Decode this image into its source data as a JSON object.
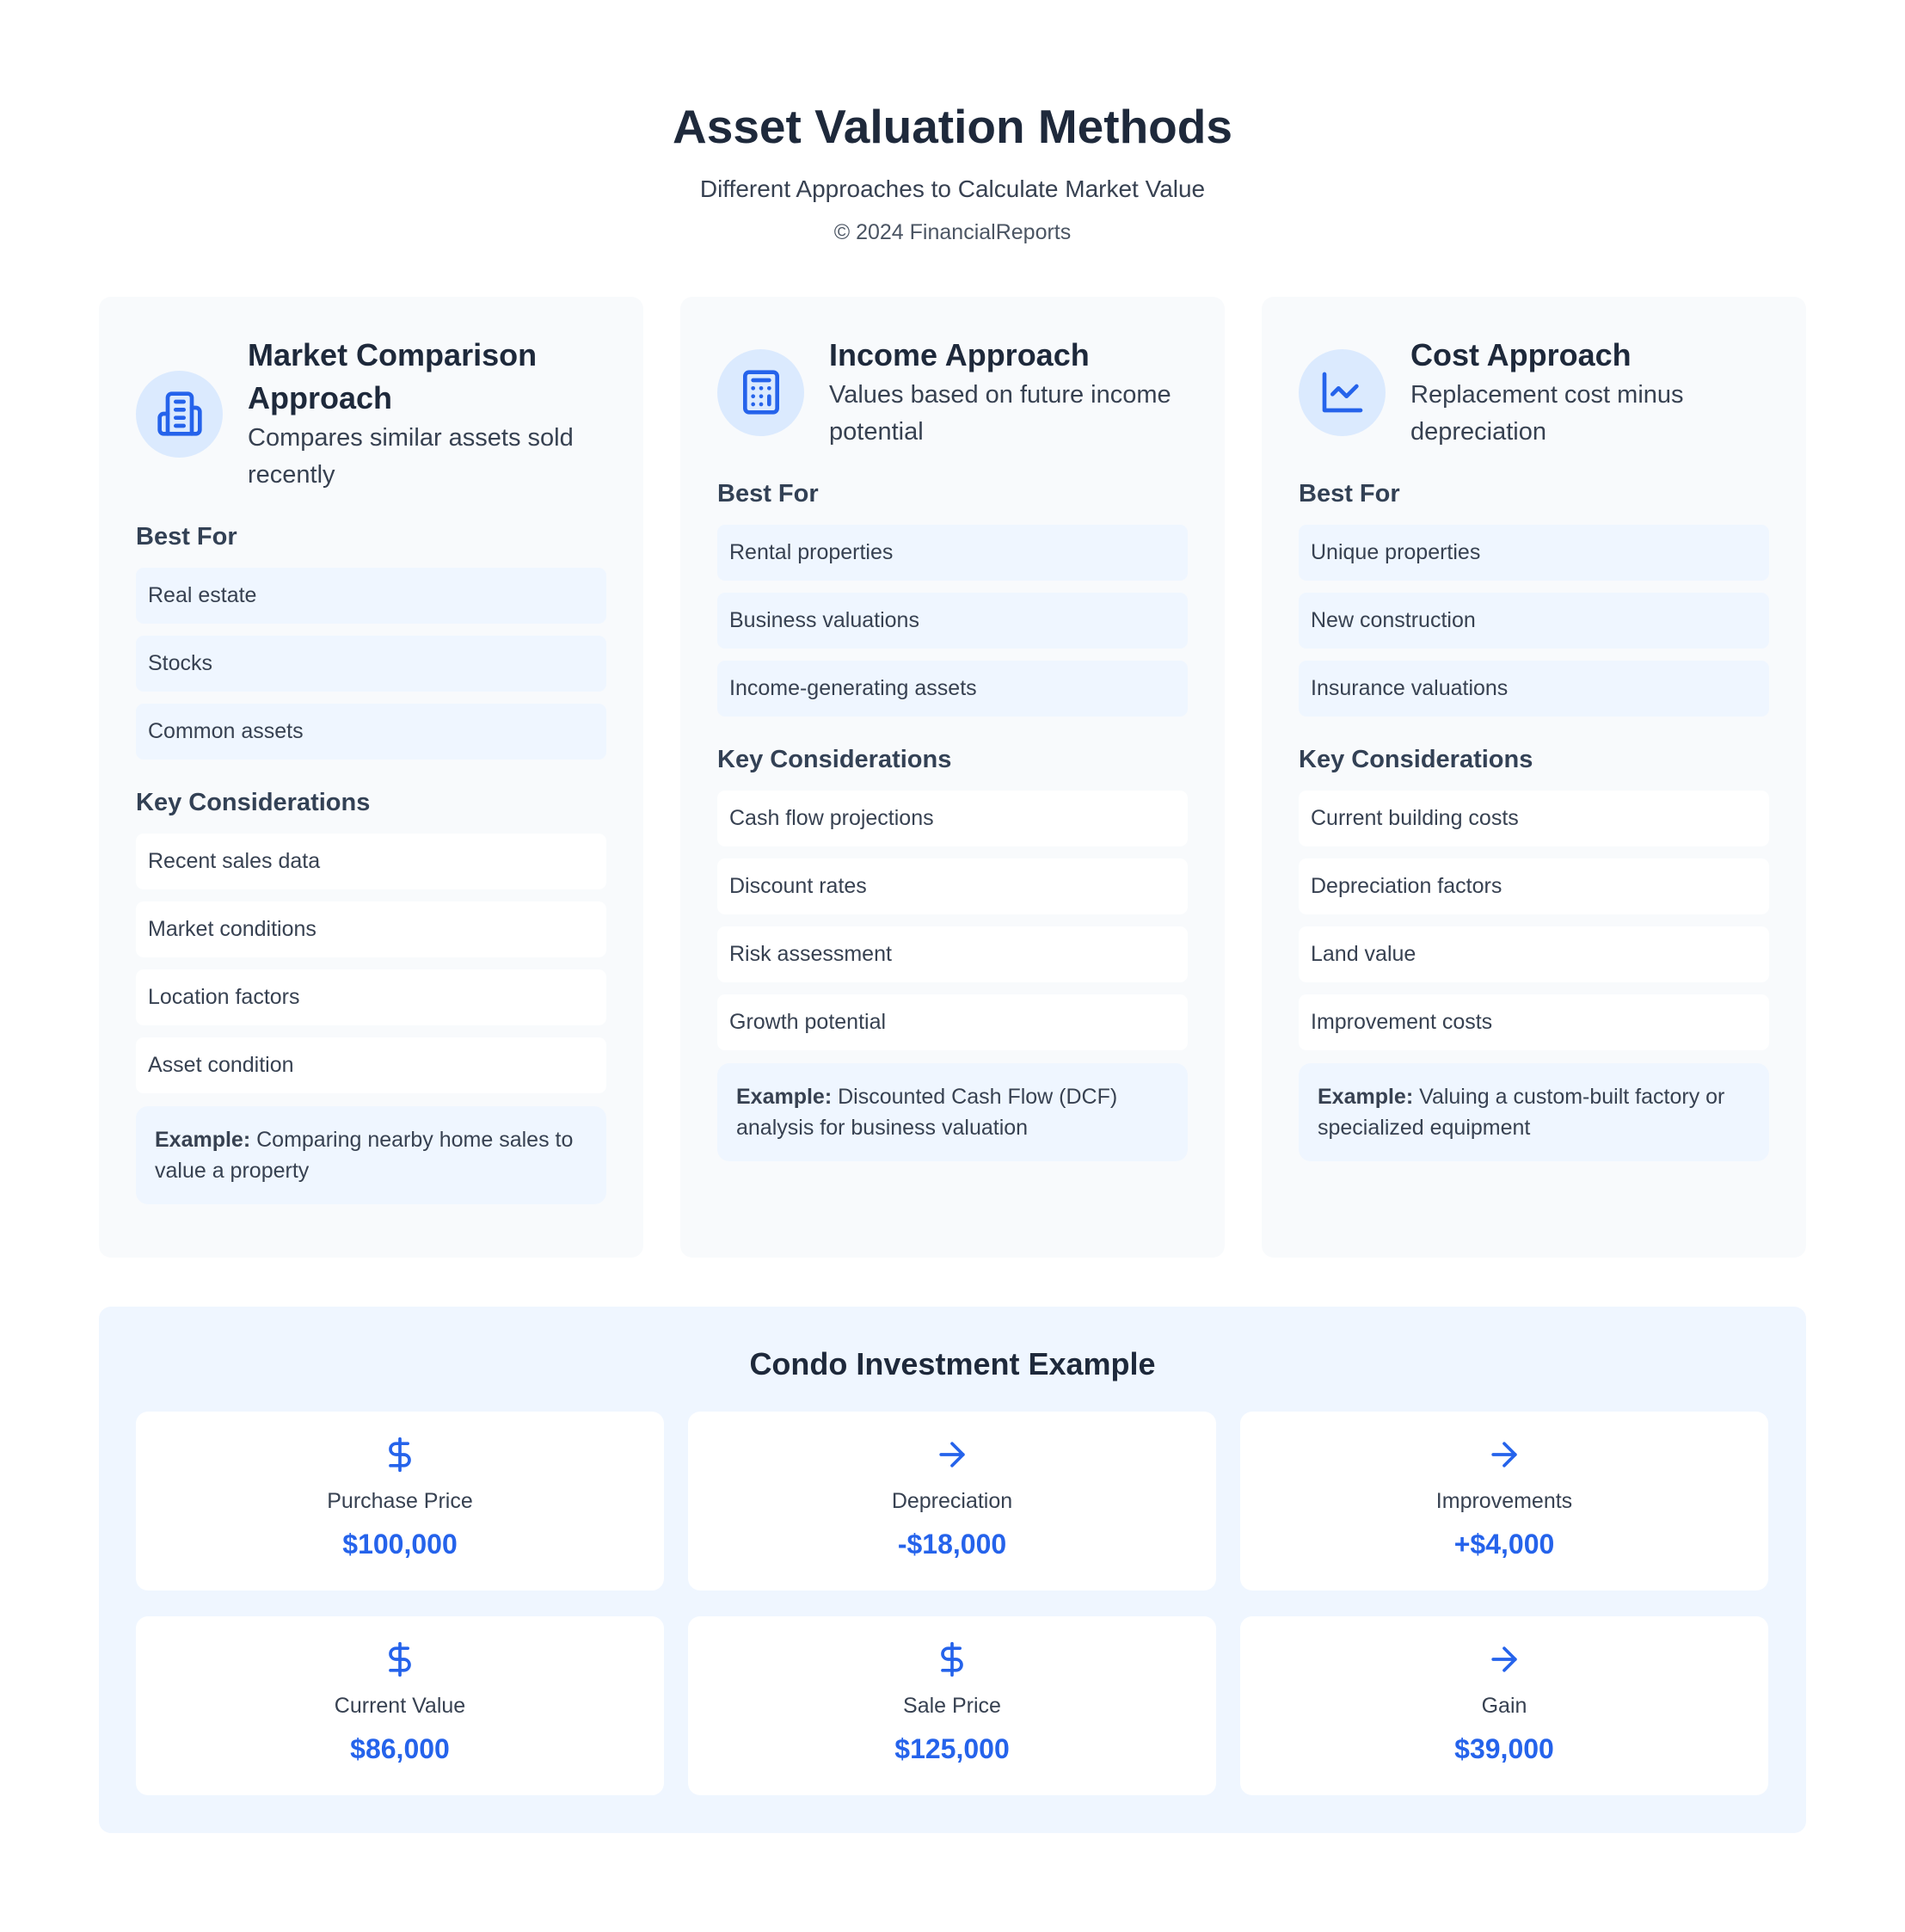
{
  "header": {
    "title": "Asset Valuation Methods",
    "subtitle": "Different Approaches to Calculate Market Value",
    "copyright": "© 2024 FinancialReports"
  },
  "colors": {
    "accent": "#2563eb",
    "icon_bg": "#dbeafe",
    "card_bg": "#f8fafc",
    "light_blue": "#eff6ff"
  },
  "methods": [
    {
      "icon": "building-icon",
      "title": "Market Comparison Approach",
      "description": "Compares similar assets sold recently",
      "best_for_label": "Best For",
      "best_for": [
        "Real estate",
        "Stocks",
        "Common assets"
      ],
      "key_label": "Key Considerations",
      "key_considerations": [
        "Recent sales data",
        "Market conditions",
        "Location factors",
        "Asset condition"
      ],
      "example_label": "Example:",
      "example_text": "Comparing nearby home sales to value a property"
    },
    {
      "icon": "calculator-icon",
      "title": "Income Approach",
      "description": "Values based on future income potential",
      "best_for_label": "Best For",
      "best_for": [
        "Rental properties",
        "Business valuations",
        "Income-generating assets"
      ],
      "key_label": "Key Considerations",
      "key_considerations": [
        "Cash flow projections",
        "Discount rates",
        "Risk assessment",
        "Growth potential"
      ],
      "example_label": "Example:",
      "example_text": "Discounted Cash Flow (DCF) analysis for business valuation"
    },
    {
      "icon": "line-chart-icon",
      "title": "Cost Approach",
      "description": "Replacement cost minus depreciation",
      "best_for_label": "Best For",
      "best_for": [
        "Unique properties",
        "New construction",
        "Insurance valuations"
      ],
      "key_label": "Key Considerations",
      "key_considerations": [
        "Current building costs",
        "Depreciation factors",
        "Land value",
        "Improvement costs"
      ],
      "example_label": "Example:",
      "example_text": "Valuing a custom-built factory or specialized equipment"
    }
  ],
  "condo": {
    "title": "Condo Investment Example",
    "tiles": [
      {
        "icon": "dollar-icon",
        "label": "Purchase Price",
        "value": "$100,000"
      },
      {
        "icon": "arrow-right-icon",
        "label": "Depreciation",
        "value": "-$18,000"
      },
      {
        "icon": "arrow-right-icon",
        "label": "Improvements",
        "value": "+$4,000"
      },
      {
        "icon": "dollar-icon",
        "label": "Current Value",
        "value": "$86,000"
      },
      {
        "icon": "dollar-icon",
        "label": "Sale Price",
        "value": "$125,000"
      },
      {
        "icon": "arrow-right-icon",
        "label": "Gain",
        "value": "$39,000"
      }
    ]
  }
}
